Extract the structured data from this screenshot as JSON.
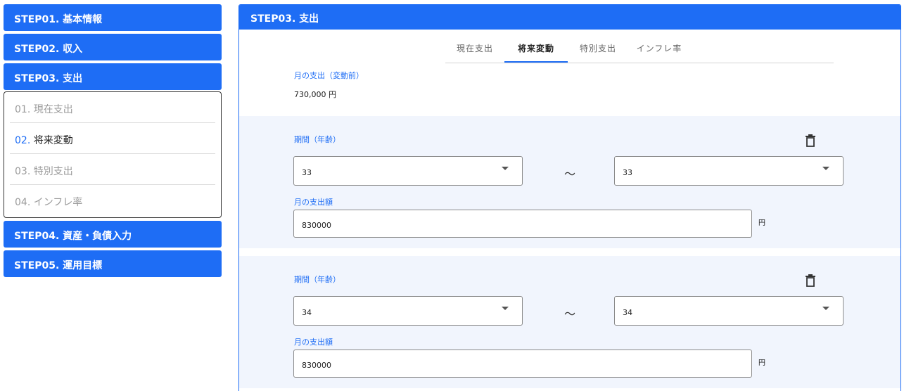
{
  "sidebar": {
    "steps": [
      {
        "label": "STEP01. 基本情報"
      },
      {
        "label": "STEP02. 収入"
      },
      {
        "label": "STEP03. 支出"
      },
      {
        "label": "STEP04. 資産・負債入力"
      },
      {
        "label": "STEP05. 運用目標"
      }
    ],
    "substeps": [
      {
        "num": "01.",
        "label": "現在支出"
      },
      {
        "num": "02.",
        "label": "将来変動"
      },
      {
        "num": "03.",
        "label": "特別支出"
      },
      {
        "num": "04.",
        "label": "インフレ率"
      }
    ],
    "active_substep": 1
  },
  "panel": {
    "title": "STEP03. 支出",
    "tabs": [
      "現在支出",
      "将来変動",
      "特別支出",
      "インフレ率"
    ],
    "active_tab": 1,
    "base_label": "月の支出（変動前）",
    "base_value": "730,000 円"
  },
  "periods": [
    {
      "label": "期間（年齢）",
      "from": "33",
      "tilde": "～",
      "to": "33",
      "amount_label": "月の支出額",
      "amount": "830000",
      "unit": "円"
    },
    {
      "label": "期間（年齢）",
      "from": "34",
      "tilde": "～",
      "to": "34",
      "amount_label": "月の支出額",
      "amount": "830000",
      "unit": "円"
    }
  ],
  "colors": {
    "accent": "#1e6df5",
    "block_bg": "#f1f5fd"
  },
  "icons": {
    "delete": "trash-icon",
    "dropdown": "chevron-down-icon"
  }
}
